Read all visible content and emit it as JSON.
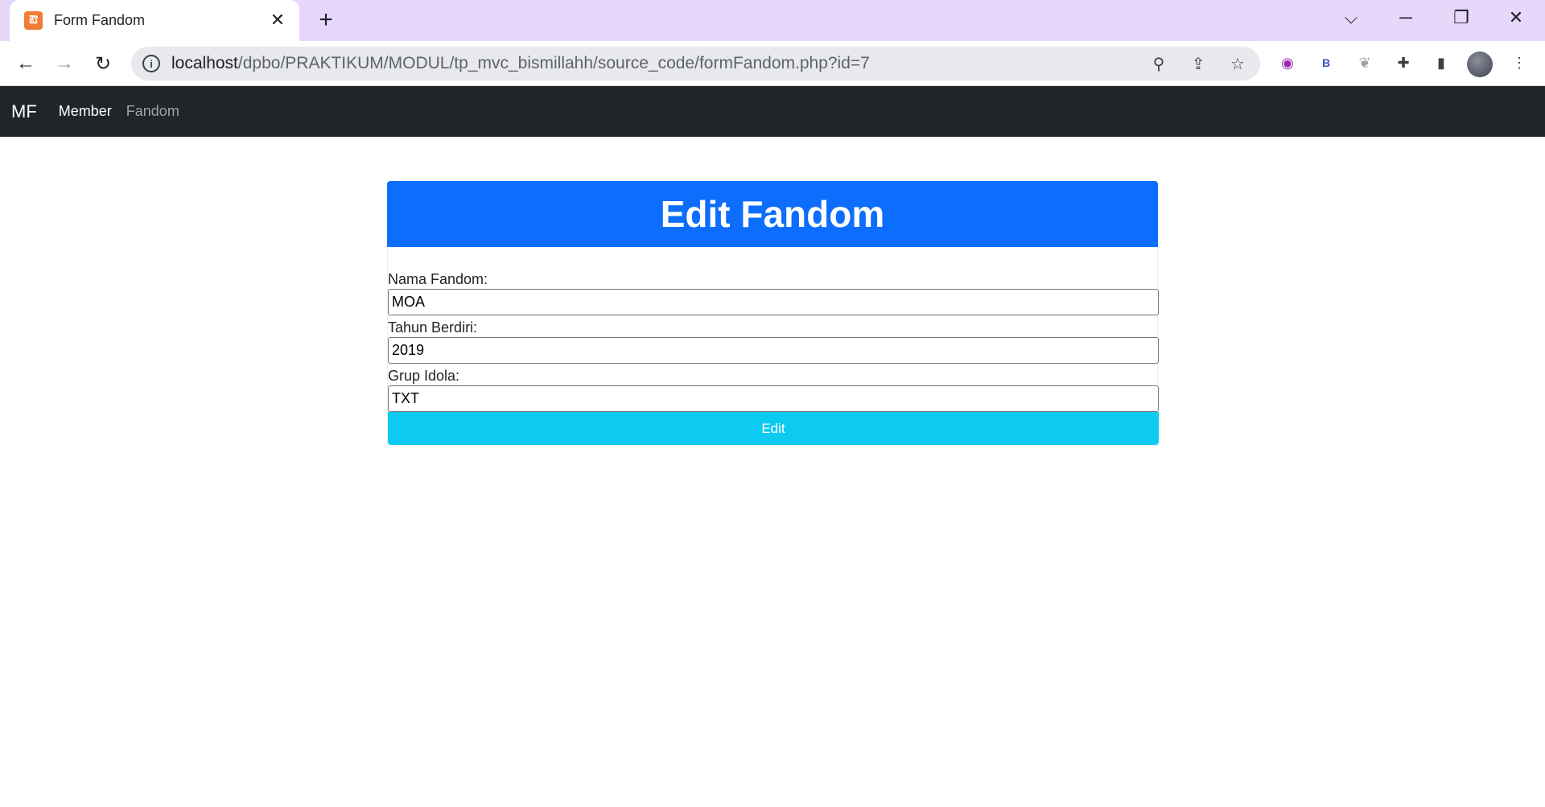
{
  "browser": {
    "tab_title": "Form Fandom",
    "tab_favicon": "xampp-icon",
    "url_host": "localhost",
    "url_path": "/dpbo/PRAKTIKUM/MODUL/tp_mvc_bismillahh/source_code/formFandom.php?id=7",
    "extensions": [
      "podcast-extension-icon",
      "b-extension-icon",
      "feather-extension-icon",
      "puzzle-icon",
      "sidepanel-icon"
    ],
    "ext_b_label": "B"
  },
  "navbar": {
    "brand": "MF",
    "links": [
      {
        "label": "Member",
        "state": "active"
      },
      {
        "label": "Fandom",
        "state": "muted"
      }
    ]
  },
  "form": {
    "title": "Edit Fandom",
    "fields": [
      {
        "label": "Nama Fandom:",
        "value": "MOA"
      },
      {
        "label": "Tahun Berdiri:",
        "value": "2019"
      },
      {
        "label": "Grup Idola:",
        "value": "TXT"
      }
    ],
    "submit_label": "Edit"
  },
  "colors": {
    "header_blue": "#0d6efd",
    "button_cyan": "#0dcaf0",
    "navbar_dark": "#212529",
    "tabstrip": "#e6d7fb"
  }
}
